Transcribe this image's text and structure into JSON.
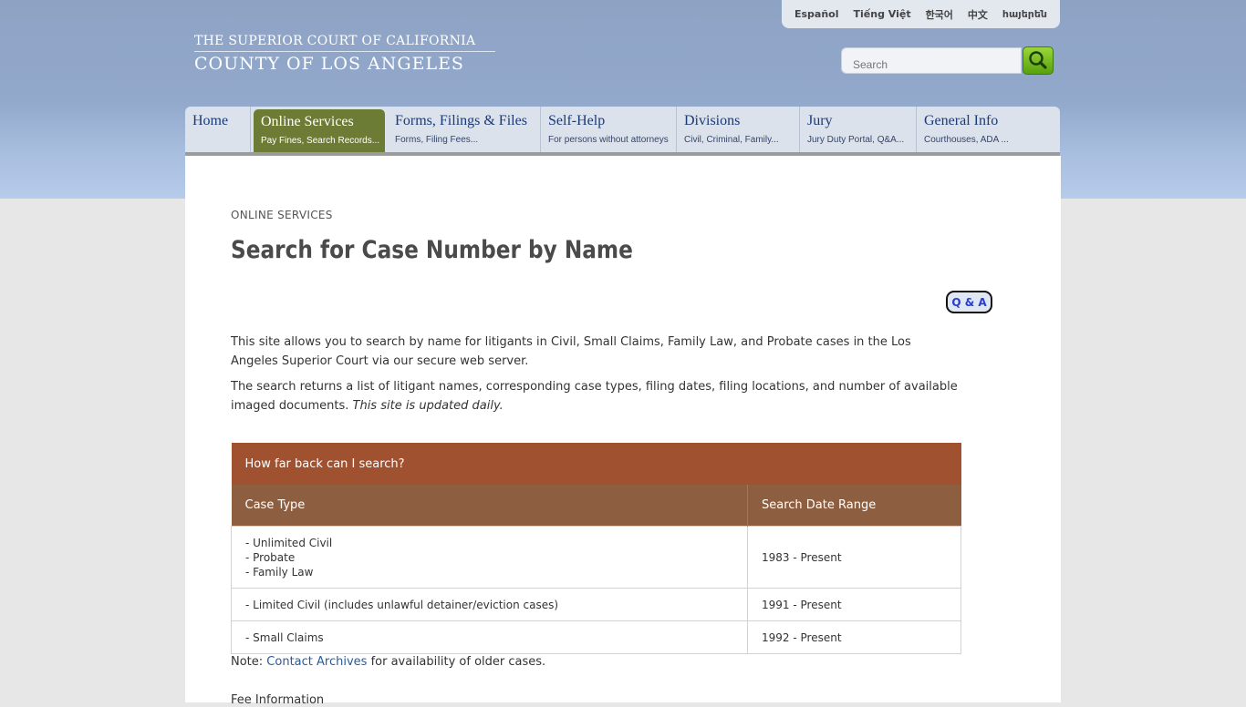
{
  "languages": [
    "Español",
    "Tiếng Việt",
    "한국어",
    "中文",
    "հայերեն"
  ],
  "logo": {
    "line1": "THE SUPERIOR COURT OF CALIFORNIA",
    "line2": "COUNTY OF LOS ANGELES"
  },
  "search": {
    "placeholder": "Search"
  },
  "nav": [
    {
      "title": "Home",
      "sub": ""
    },
    {
      "title": "Online Services",
      "sub": "Pay Fines, Search Records..."
    },
    {
      "title": "Forms, Filings & Files",
      "sub": "Forms, Filing Fees..."
    },
    {
      "title": "Self-Help",
      "sub": "For persons without attorneys"
    },
    {
      "title": "Divisions",
      "sub": "Civil, Criminal, Family..."
    },
    {
      "title": "Jury",
      "sub": "Jury Duty Portal, Q&A..."
    },
    {
      "title": "General Info",
      "sub": "Courthouses, ADA ..."
    }
  ],
  "page": {
    "eyebrow": "ONLINE SERVICES",
    "title": "Search for Case Number by Name",
    "qa_label": "Q & A",
    "para1": "This site allows you to search by name for litigants in Civil, Small Claims, Family Law, and Probate cases in the Los Angeles Superior Court via our secure web server.",
    "para2": "The search returns a list of litigant names, corresponding case types, filing dates, filing locations, and number of available imaged documents.",
    "para2_em": "This site is updated daily.",
    "table": {
      "caption": "How far back can I search?",
      "headers": [
        "Case Type",
        "Search Date Range"
      ],
      "rows": [
        {
          "types": [
            "- Unlimited Civil",
            "- Probate",
            "- Family Law"
          ],
          "range": "1983 - Present"
        },
        {
          "types": [
            "- Limited Civil (includes unlawful detainer/eviction cases)"
          ],
          "range": "1991 - Present"
        },
        {
          "types": [
            "- Small Claims"
          ],
          "range": "1992 - Present"
        }
      ]
    },
    "note_prefix": "Note:",
    "note_link": "Contact Archives",
    "note_suffix": "for availability of older cases.",
    "fee_heading": "Fee Information"
  }
}
